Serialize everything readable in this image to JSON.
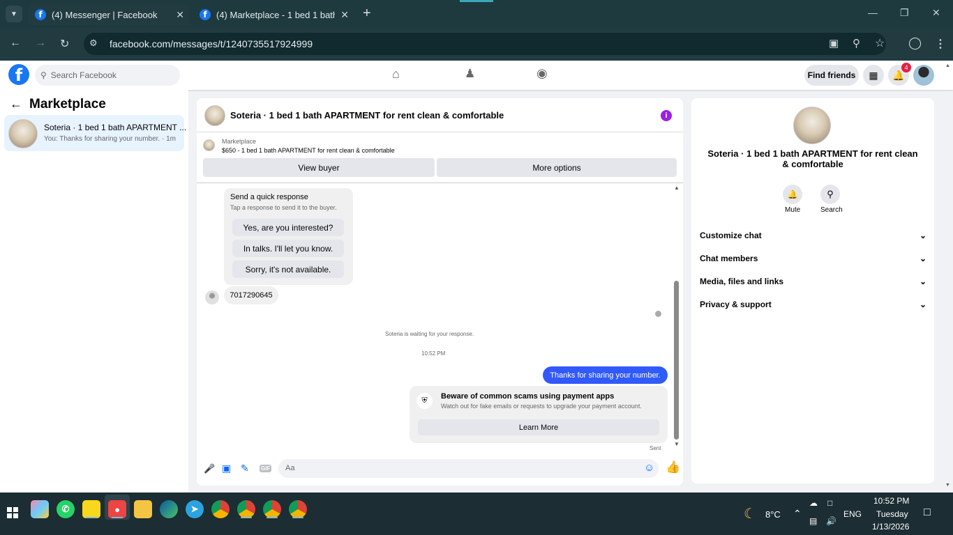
{
  "browser": {
    "tabs": [
      {
        "label": "(4) Messenger | Facebook"
      },
      {
        "label": "(4) Marketplace - 1 bed 1 bath"
      }
    ],
    "url": "facebook.com/messages/t/1240735517924999"
  },
  "fb_header": {
    "search_placeholder": "Search Facebook",
    "find_friends": "Find friends",
    "notif_count": "4"
  },
  "sidebar": {
    "title": "Marketplace",
    "conversation": {
      "name": "Soteria · 1 bed 1 bath APARTMENT ...",
      "preview": "You: Thanks for sharing your number. · 1m"
    }
  },
  "chat": {
    "title": "Soteria · 1 bed 1 bath APARTMENT for rent clean & comfortable",
    "listing_source": "Marketplace",
    "listing_line": "$650 - 1 bed 1 bath APARTMENT for rent clean & comfortable",
    "view_buyer": "View buyer",
    "more_options": "More options",
    "quick": {
      "title": "Send a quick response",
      "subtitle": "Tap a response to send it to the buyer.",
      "options": [
        "Yes, are you interested?",
        "In talks. I'll let you know.",
        "Sorry, it's not available."
      ]
    },
    "phone_msg": "7017290645",
    "waiting": "Soteria is waiting for your response.",
    "time": "10:52 PM",
    "sent_msg": "Thanks for sharing your number.",
    "scam": {
      "title": "Beware of common scams using payment apps",
      "subtitle": "Watch out for fake emails or requests to upgrade your payment account.",
      "button": "Learn More"
    },
    "status": "Sent",
    "composer_placeholder": "Aa",
    "gif_label": "GIF"
  },
  "details": {
    "title": "Soteria · 1 bed 1 bath APARTMENT for rent clean & comfortable",
    "mute": "Mute",
    "search": "Search",
    "sections": [
      "Customize chat",
      "Chat members",
      "Media, files and links",
      "Privacy & support"
    ]
  },
  "taskbar": {
    "temp": "8°C",
    "lang": "ENG",
    "time": "10:52 PM",
    "day": "Tuesday",
    "date": "1/13/2026"
  }
}
